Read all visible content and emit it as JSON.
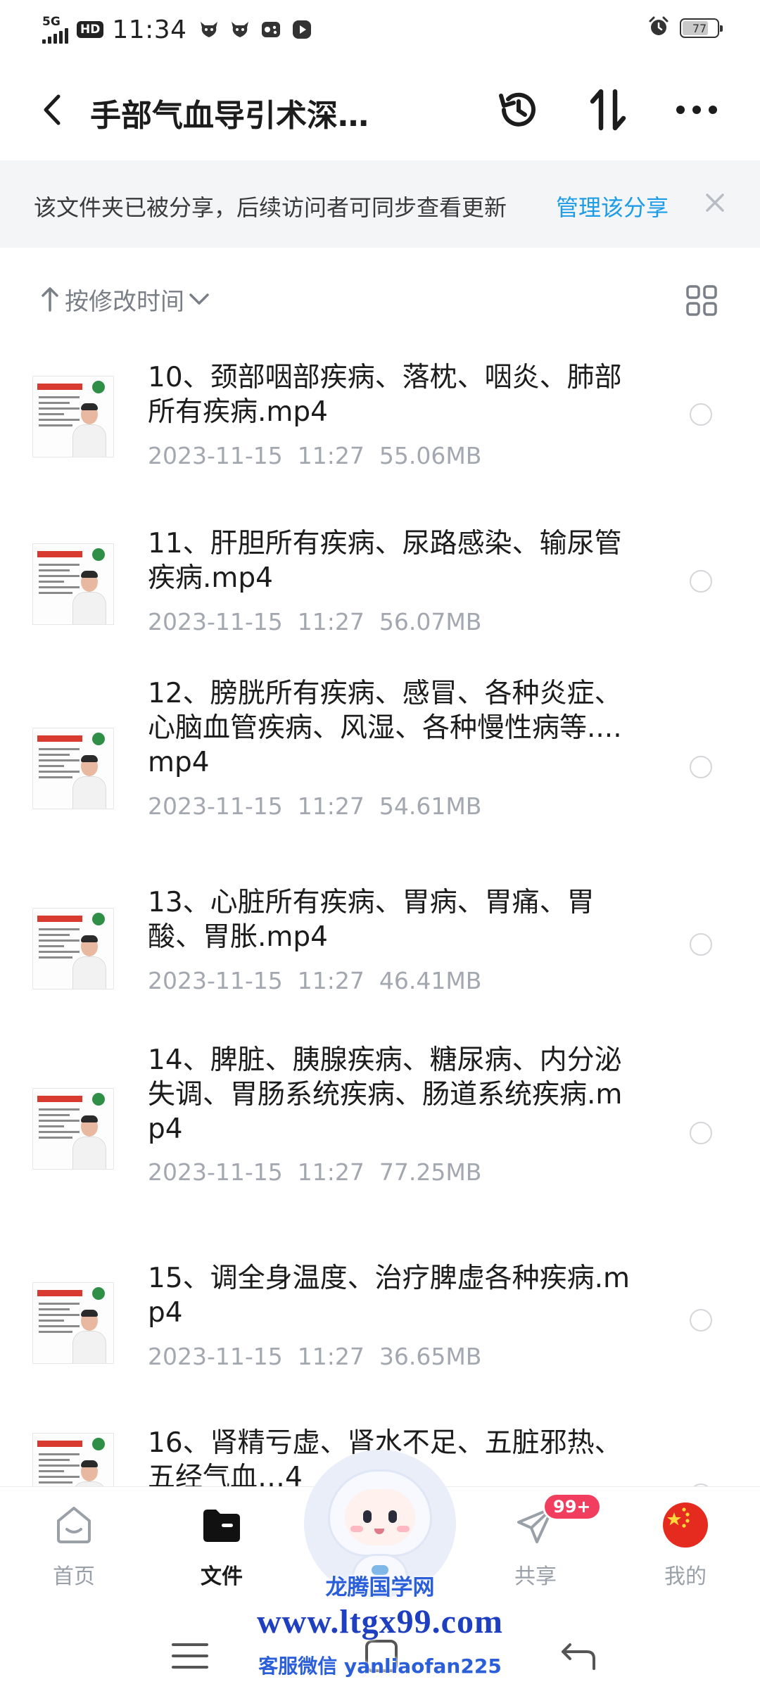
{
  "status_bar": {
    "network": "5G",
    "hd": "HD",
    "time": "11:34",
    "app_icons": [
      "cow-icon",
      "cow-icon",
      "gamepad-icon",
      "play-icon"
    ],
    "alarm_icon": "alarm-icon",
    "battery": "77",
    "battery_level": 0.77
  },
  "header": {
    "title": "手部气血导引术深…",
    "back_icon": "back-arrow-icon",
    "actions": [
      "history-icon",
      "sort-swap-icon",
      "more-icon"
    ]
  },
  "share_banner": {
    "text": "该文件夹已被分享，后续访问者可同步查看更新",
    "link": "管理该分享",
    "close_icon": "close-icon"
  },
  "sort": {
    "label": "按修改时间",
    "direction_icon": "arrow-up-icon",
    "dropdown_icon": "chevron-down-icon",
    "view_icon": "grid-view-icon"
  },
  "files": [
    {
      "name": "10、颈部咽部疾病、落枕、咽炎、肺部所有疾病.mp4",
      "date": "2023-11-15",
      "time": "11:27",
      "size": "55.06MB"
    },
    {
      "name": "11、肝胆所有疾病、尿路感染、输尿管疾病.mp4",
      "date": "2023-11-15",
      "time": "11:27",
      "size": "56.07MB"
    },
    {
      "name": "12、膀胱所有疾病、感冒、各种炎症、心脑血管疾病、风湿、各种慢性病等....mp4",
      "date": "2023-11-15",
      "time": "11:27",
      "size": "54.61MB"
    },
    {
      "name": "13、心脏所有疾病、胃病、胃痛、胃酸、胃胀.mp4",
      "date": "2023-11-15",
      "time": "11:27",
      "size": "46.41MB"
    },
    {
      "name": "14、脾脏、胰腺疾病、糖尿病、内分泌失调、胃肠系统疾病、肠道系统疾病.mp4",
      "date": "2023-11-15",
      "time": "11:27",
      "size": "77.25MB"
    },
    {
      "name": "15、调全身温度、治疗脾虚各种疾病.mp4",
      "date": "2023-11-15",
      "time": "11:27",
      "size": "36.65MB"
    },
    {
      "name": "16、肾精亏虚、肾水不足、五脏邪热、五经气血…4",
      "date": "",
      "time": "",
      "size": ""
    }
  ],
  "bottom_nav": {
    "items": [
      {
        "label": "首页",
        "icon": "home-icon",
        "active": false
      },
      {
        "label": "文件",
        "icon": "folder-icon",
        "active": true
      },
      {
        "label": "共享",
        "icon": "paper-plane-icon",
        "active": false,
        "badge": "99+"
      },
      {
        "label": "我的",
        "icon": "china-flag-avatar-icon",
        "active": false
      }
    ],
    "assistant_icon": "ai-assistant-mascot-icon"
  },
  "system_nav": [
    "menu-icon",
    "home-square-icon",
    "back-return-icon"
  ],
  "watermark": {
    "title": "龙腾国学网",
    "url": "www.ltgx99.com",
    "contact": "客服微信 yanliaofan225"
  },
  "colors": {
    "accent": "#1e9ce6",
    "badge": "#f23e5e",
    "meta_text": "#a3a8b0",
    "banner_bg": "#f4f5f7"
  }
}
